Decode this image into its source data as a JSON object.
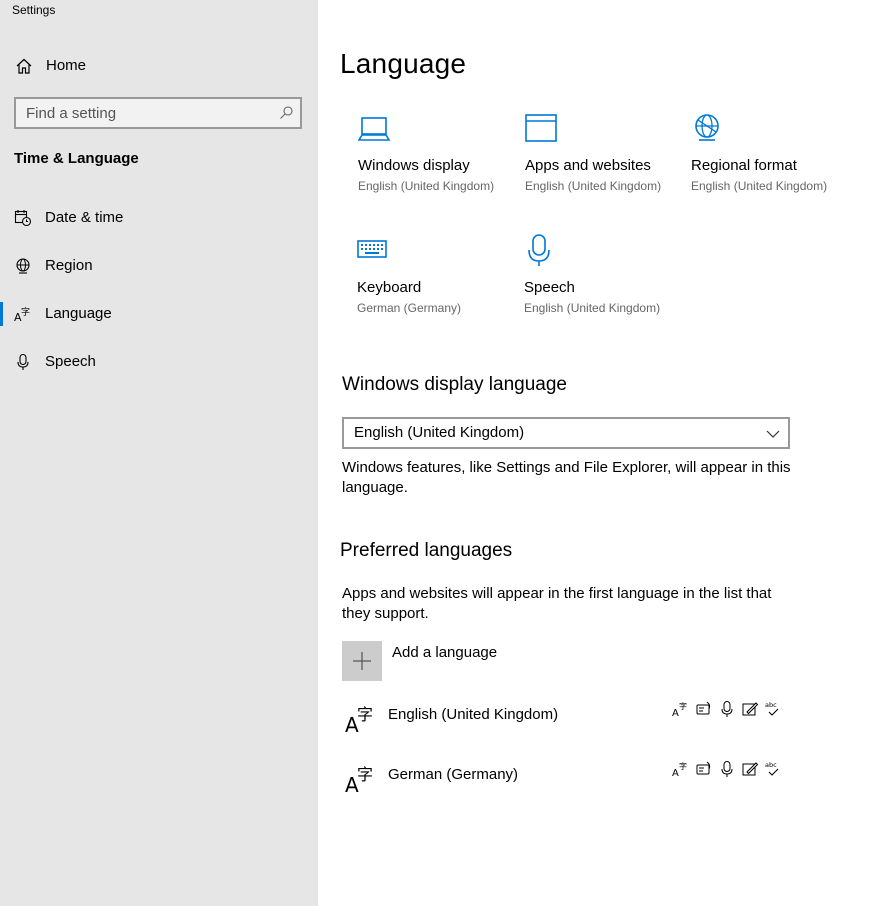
{
  "window": {
    "title": "Settings"
  },
  "sidebar": {
    "home_label": "Home",
    "search": {
      "placeholder": "Find a setting"
    },
    "section_title": "Time & Language",
    "items": [
      {
        "label": "Date & time",
        "icon": "calendar-clock-icon"
      },
      {
        "label": "Region",
        "icon": "globe-icon"
      },
      {
        "label": "Language",
        "icon": "language-icon",
        "selected": true
      },
      {
        "label": "Speech",
        "icon": "microphone-icon"
      }
    ]
  },
  "main": {
    "title": "Language",
    "tiles": [
      {
        "label": "Windows display",
        "sub": "English (United Kingdom)",
        "icon": "laptop-icon"
      },
      {
        "label": "Apps and websites",
        "sub": "English (United Kingdom)",
        "icon": "window-icon"
      },
      {
        "label": "Regional format",
        "sub": "English (United Kingdom)",
        "icon": "globe-icon"
      },
      {
        "label": "Keyboard",
        "sub": "German (Germany)",
        "icon": "keyboard-icon"
      },
      {
        "label": "Speech",
        "sub": "English (United Kingdom)",
        "icon": "microphone-icon"
      }
    ],
    "display_language": {
      "heading": "Windows display language",
      "selected": "English (United Kingdom)",
      "description": "Windows features, like Settings and File Explorer, will appear in this language."
    },
    "preferred": {
      "heading": "Preferred languages",
      "description": "Apps and websites will appear in the first language in the list that they support.",
      "add_label": "Add a language",
      "languages": [
        {
          "name": "English (United Kingdom)"
        },
        {
          "name": "German (Germany)"
        }
      ],
      "feature_icons": [
        "display-language-icon",
        "text-to-speech-icon",
        "speech-recognition-icon",
        "handwriting-icon",
        "spellcheck-icon"
      ],
      "spellcheck_text": "abc"
    }
  },
  "colors": {
    "accent": "#0078d7",
    "sidebar_bg": "#e6e6e6"
  }
}
